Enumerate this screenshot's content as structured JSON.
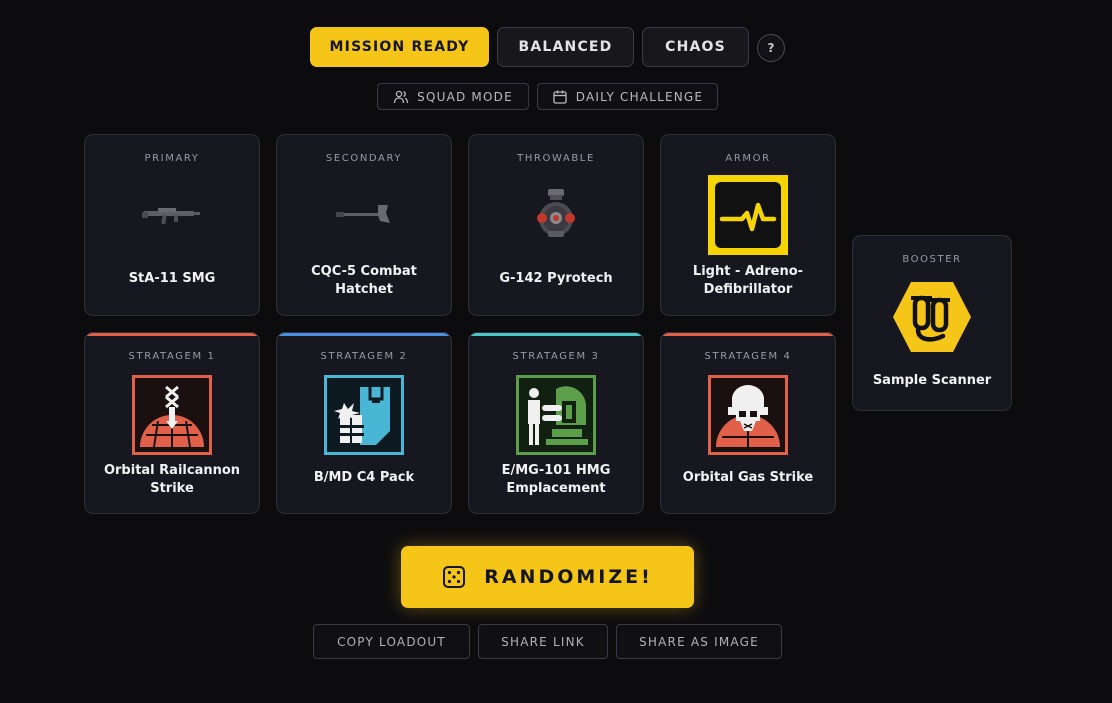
{
  "modes": [
    {
      "label": "MISSION READY",
      "active": true
    },
    {
      "label": "BALANCED",
      "active": false
    },
    {
      "label": "CHAOS",
      "active": false
    }
  ],
  "help_label": "?",
  "sub_options": {
    "squad_mode": {
      "label": "SQUAD MODE",
      "icon": "users-icon"
    },
    "daily_challenge": {
      "label": "DAILY CHALLENGE",
      "icon": "calendar-icon"
    }
  },
  "loadout": {
    "primary": {
      "category": "PRIMARY",
      "name": "StA-11 SMG"
    },
    "secondary": {
      "category": "SECONDARY",
      "name": "CQC-5 Combat Hatchet"
    },
    "throwable": {
      "category": "THROWABLE",
      "name": "G-142 Pyrotech"
    },
    "armor": {
      "category": "ARMOR",
      "name": "Light - Adreno-Defibrillator"
    },
    "booster": {
      "category": "BOOSTER",
      "name": "Sample Scanner"
    }
  },
  "stratagems": [
    {
      "category": "STRATAGEM 1",
      "name": "Orbital Railcannon Strike",
      "accent": "#e0604a"
    },
    {
      "category": "STRATAGEM 2",
      "name": "B/MD C4 Pack",
      "accent": "#4a8fe0"
    },
    {
      "category": "STRATAGEM 3",
      "name": "E/MG-101 HMG Emplacement",
      "accent": "#4ac8c8"
    },
    {
      "category": "STRATAGEM 4",
      "name": "Orbital Gas Strike",
      "accent": "#e0604a"
    }
  ],
  "randomize": {
    "label": "RANDOMIZE!",
    "icon": "dice-icon"
  },
  "actions": {
    "copy": "COPY LOADOUT",
    "share_link": "SHARE LINK",
    "share_image": "SHARE AS IMAGE"
  },
  "colors": {
    "accent": "#f5c518",
    "background": "#0c0c0f",
    "card": "#17171f",
    "orbital": "#e0604a",
    "supply": "#4a8fe0",
    "defense": "#4ac8c8"
  }
}
